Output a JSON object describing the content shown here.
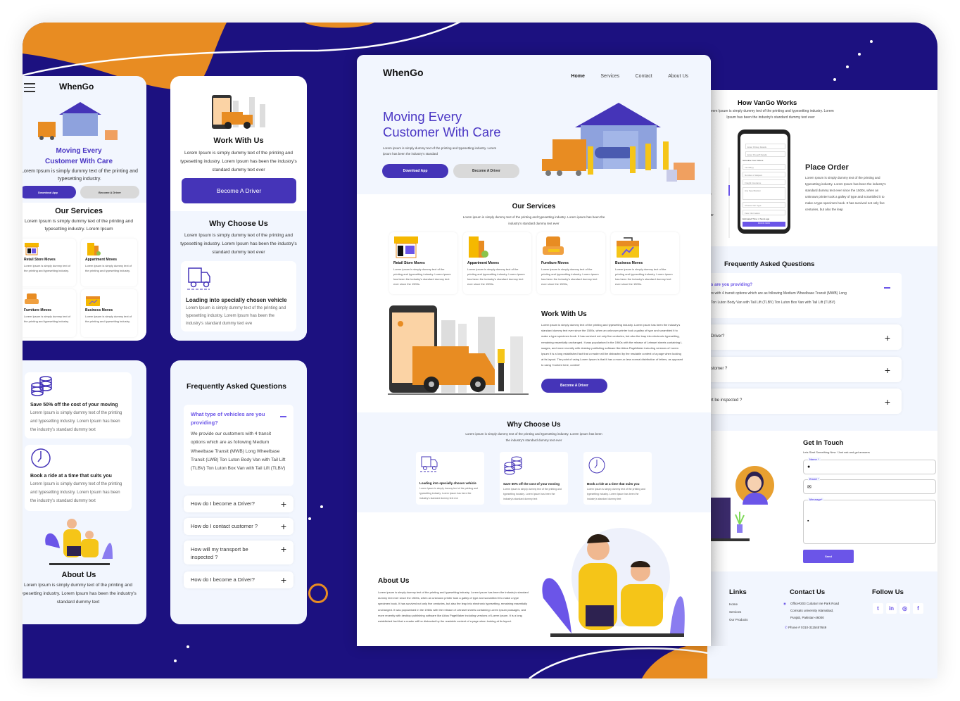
{
  "brand": "WhenGo",
  "colors": {
    "primary": "#4534b8",
    "accent": "#e88c22",
    "background": "#1c1180",
    "faq_active": "#6b55e8"
  },
  "nav": {
    "items": [
      "Home",
      "Services",
      "Contact",
      "About Us"
    ],
    "active": "Home"
  },
  "hero": {
    "title_line1": "Moving Every",
    "title_line2": "Customer With Care",
    "text": "Lorem ipsum is simply dummy text of the printing and typesetting industry. Lorem ipsum has been the industry's standard",
    "mobile_text": "Lorem Ipsum is simply dummy text of the printing and typesetting industry.",
    "download_btn": "Download App",
    "driver_btn": "Become A Driver"
  },
  "services": {
    "title": "Our Services",
    "subtitle": "Lorem ipsum is simply dummy text of the printing and typesetting industry. Lorem ipsum has been the industry's standard dummy text ever",
    "mobile_subtitle": "Lorem Ipsum is simply dummy text of the printing and typesetting industry. Lorem Ipsum",
    "items": [
      {
        "icon": "storefront-icon",
        "title": "Retail Store Moves",
        "text": "Lorem ipsum is simply dummy text of the printing and typesetting industry. Lorem ipsum has been the industry's standard dummy text ever since the 1500s.",
        "mobile_text": "Lorem Ipsum is simply dummy text of the printing and typesetting industry."
      },
      {
        "icon": "apartment-icon",
        "title": "Appartment Moves",
        "text": "Lorem ipsum is simply dummy text of the printing and typesetting industry. Lorem ipsum has been the industry's standard dummy text ever since the 1500s.",
        "mobile_text": "Lorem Ipsum is simply dummy text of the printing and typesetting industry."
      },
      {
        "icon": "armchair-icon",
        "title": "Furniture Moves",
        "text": "Lorem ipsum is simply dummy text of the printing and typesetting industry. Lorem ipsum has been the industry's standard dummy text ever since the 1500s,",
        "mobile_text": "Lorem Ipsum is simply dummy text of the printing and typesetting industry."
      },
      {
        "icon": "briefcase-icon",
        "title": "Business Moves",
        "text": "Lorem ipsum is simply dummy text of the printing and typesetting industry. Lorem ipsum has been the industry's standard dummy text ever since the 1500s.",
        "mobile_text": "Lorem Ipsum is simply dummy text of the printing and typesetting industry."
      }
    ]
  },
  "work": {
    "title": "Work With Us",
    "text": "Lorem ipsum is simply dummy text of the printing and typesetting industry. Lorem ipsum has been the industry's standard dummy text ever since the 1500s, when an unknown printer took a galley of type and scrambled it to make a type specimen book. It has survived not only five centuries, but also the leap into electronic typesetting, remaining essentially unchanged. It was popularised in the 1960s with the release of Letraset sheets containing L ssages, and more recently with desktop publishing software like Aldus PageMaker including versions of Lorem Ipsum It is a long established fact that a reader will be distracted by the readable content of a page when looking at its layout. The point of using Lorem Ipsum is that it has a more-or-less normal distribution of letters, as opposed to using 'Content here, content'",
    "mobile_text": "Lorem Ipsum is simply dummy text of the printing and typesetting industry. Lorem Ipsum has been the industry's standard dummy text ever",
    "button": "Become A Driver"
  },
  "why": {
    "title": "Why Choose Us",
    "subtitle": "Lorem ipsum is simply dummy text of the printing and typesetting industry. Lorem ipsum has been the industry's standard dummy text ever",
    "items": [
      {
        "icon": "truck-icon",
        "title": "Loading into specially chosen vehicle",
        "text": "Lorem Ipsum is simply dummy text of the printing and typesetting industry. Lorem Ipsum has been the industry's standard dummy text eve"
      },
      {
        "icon": "coins-icon",
        "title": "Save 50% off the cost of your moving",
        "text": "Lorem Ipsum is simply dummy text of the printing and typesetting industry. Lorem Ipsum has been the industry's standard dummy text"
      },
      {
        "icon": "clock-icon",
        "title": "Book a ride at a time that suits you",
        "text": "Lorem Ipsum is simply dummy text of the printing and typesetting industry. Lorem Ipsum has been the industry's standard dummy text"
      }
    ]
  },
  "about": {
    "title": "About Us",
    "text": "Lorem ipsum is simply dummy text of the printing and typesetting industry. Lorem ipsum has been the industry's standard dummy text ever since the 1500s, when an unknown printer took a galley of type and scrambled it to make a type specimen book. It has survived not only five centuries, but also the leap into electronic typesetting, remaining essentially unchanged. It was popularised in the 1960s with the release of Letraset sheets containing Lorem Ipsum passages, and more recently with desktop publishing software like Aldus PageMaker including versions of Lorem Ipsum. It is a long established fact that a reader will be distracted by the readable content of a page when looking at its layout.",
    "mobile_text": "Lorem Ipsum is simply dummy text of the printing and typesetting industry. Lorem Ipsum has been the industry's standard dummy text"
  },
  "how": {
    "title": "How VanGo Works",
    "subtitle": "Lorem Ipsum is simply dummy text of the printing and typesetting industry. Lorem Ipsum has been the industry's standard dummy text ever",
    "step_title": "Place Order",
    "step_text": "Lorem Ipsum is simply dummy text of the printing and typesetting industry. Lorem Ipsum has been the industry's standard dummy text ever since the 1500s, when an unknown printer took a galley of type and scrambled it to make a type specimen book. It has survived not only five centuries, but also the leap",
    "side_labels": [
      "ng",
      "rder"
    ],
    "phone": {
      "pickup": "Enter Pickup Details",
      "dropoff": "Enter Dropoff Details",
      "schedule": "Schedule Your Orders",
      "date": "mm/dd/yy",
      "helpers": "Number of Helpers",
      "insurance": "Freight Insurance",
      "spec": "Any Specification",
      "van": "Choose Van Type",
      "payment": "Fare Information",
      "estimate": "Estimated Time: 2 hours ago",
      "book": "BOOK NOW"
    }
  },
  "faq": {
    "title": "Frequently Asked Questions",
    "active_q": "What type of vehicles are you providing?",
    "active_a": "We provide our customers with 4 transit options which are as  following Medium Wheelbase Transit (MWB) Long Wheelbase Transit (LWB) Ton Luton Body Van with Tail Lift (TLBV) Ton Luton Box Van with Tail Lift (TLBV)",
    "questions": [
      "How do I become a Driver?",
      "How do I contact customer ?",
      "How will my transport be inspected ?",
      "How do I become a Driver?"
    ],
    "desktop_partial": {
      "active_q": "s are you providing?",
      "active_a_line1": "rs with 4 transit options which are as  following Medium Wheelbase Transit (MWB) Long",
      "active_a_line2": "Ton Luton Body Van with Tail Lift (TLBV) Ton Luton Box Van with Tail Lift (TLBV)",
      "questions": [
        "Driver?",
        "stomer ?",
        "rt be inspected ?"
      ]
    }
  },
  "contact": {
    "title": "Get In Touch",
    "subtitle": "Lets Start Something New ! Just ask and get answers",
    "name_label": "Name *",
    "email_label": "Email *",
    "message_label": "Message*",
    "send": "Send"
  },
  "footer": {
    "links_title": "Links",
    "links": [
      "Home",
      "Services",
      "Our Products"
    ],
    "contact_title": "Contact Us",
    "address": [
      "Office#203 Cubator Ine Park Road",
      "Comsats university Islamabad,",
      "Punjab, Pakistan-46000"
    ],
    "phone": "Phone # 0310-3115457649",
    "follow_title": "Follow Us",
    "social": [
      "twitter-icon",
      "linkedin-icon",
      "instagram-icon",
      "facebook-icon"
    ]
  }
}
